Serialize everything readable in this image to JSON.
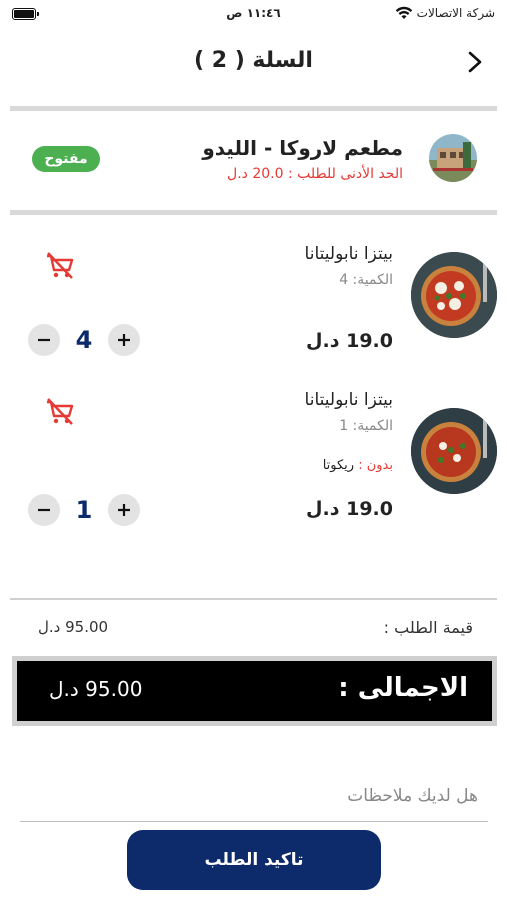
{
  "status_bar": {
    "carrier": "شركة الاتصالات",
    "time": "١١:٤٦ ص"
  },
  "header": {
    "title": "السلة ( 2 )",
    "back_icon": "chevron-right-icon"
  },
  "restaurant": {
    "name": "مطعم لاروكا - الليدو",
    "min_order": "الحد الأدنى للطلب : 20.0 د.ل",
    "status": "مفتوح",
    "status_color": "#4caf50"
  },
  "items": [
    {
      "name": "بيتزا نابوليتانا",
      "qty_label": "الكمية: 4",
      "price": "19.0 د.ل",
      "quantity": "4",
      "without_label": "",
      "without_value": ""
    },
    {
      "name": "بيتزا نابوليتانا",
      "qty_label": "الكمية: 1",
      "price": "19.0 د.ل",
      "quantity": "1",
      "without_label": "بدون :",
      "without_value": "ريكوتا"
    }
  ],
  "totals": {
    "subtotal_label": "قيمة الطلب :",
    "subtotal_value": "95.00 د.ل",
    "total_label": "الاجمالى :",
    "total_value": "95.00 د.ل"
  },
  "notes": {
    "placeholder": "هل لديك ملاحظات"
  },
  "confirm_button": {
    "label": "تاكيد الطلب"
  },
  "colors": {
    "accent": "#0d2a6b",
    "danger": "#e53935",
    "open": "#4caf50"
  }
}
